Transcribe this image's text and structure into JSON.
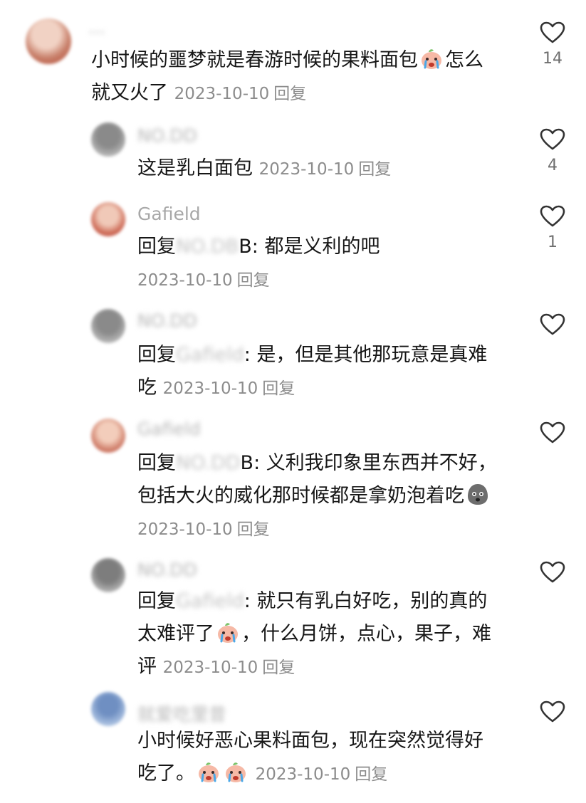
{
  "comments": [
    {
      "user": "...",
      "text_lines": [
        "小时候的噩梦就是春游时候的果料面包",
        "怎么",
        "就又火了"
      ],
      "date": "2023-10-10",
      "reply_label": "回复",
      "likes": "14"
    },
    {
      "user": "NO.DD",
      "text": "这是乳白面包",
      "date": "2023-10-10",
      "reply_label": "回复",
      "likes": "4"
    },
    {
      "user": "Gafield",
      "prefix": "回复",
      "mention": "NO.DB",
      "mention_tail": "B",
      "text": ": 都是义利的吧",
      "date": "2023-10-10",
      "reply_label": "回复",
      "likes": "1"
    },
    {
      "user": "NO.DD",
      "prefix": "回复",
      "mention": "Gafield",
      "text_lines": [
        ": 是，但是其他那玩意是真难",
        "吃"
      ],
      "date": "2023-10-10",
      "reply_label": "回复",
      "likes": ""
    },
    {
      "user": "Gafield",
      "prefix": "回复",
      "mention": "NO.DD",
      "mention_tail": "B",
      "text_lines": [
        ": 义利我印象里东西并不好，",
        "包括大火的威化那时候都是拿奶泡着吃"
      ],
      "date": "2023-10-10",
      "reply_label": "回复",
      "likes": ""
    },
    {
      "user": "NO.DD",
      "prefix": "回复",
      "mention": "Gafield",
      "text_lines": [
        ": 就只有乳白好吃，别的真的",
        "太难评了",
        "，什么月饼，点心，果子，难",
        "评"
      ],
      "date": "2023-10-10",
      "reply_label": "回复",
      "likes": ""
    },
    {
      "user": "就爱吃里昔",
      "text_lines": [
        "小时候好恶心果料面包，现在突然觉得好",
        "吃了。"
      ],
      "date": "2023-10-10",
      "reply_label": "回复",
      "likes": ""
    }
  ],
  "colors": {
    "text": "#161616",
    "meta": "#8c8c8c",
    "username": "#a8a8a8",
    "heart_stroke": "#333333"
  },
  "icons": {
    "like": "heart-outline-icon",
    "emoji_cry": "crying-peach-emoji-icon",
    "emoji_speechless": "speechless-face-emoji-icon"
  }
}
